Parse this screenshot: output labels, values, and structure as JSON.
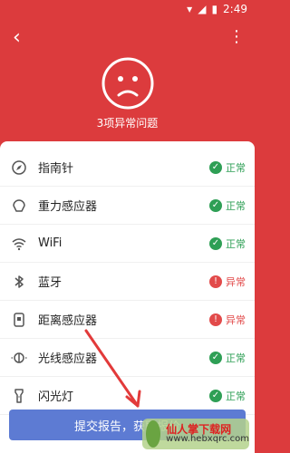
{
  "status_bar": {
    "time": "2:49",
    "icons": [
      "wifi-icon",
      "signal-icon",
      "battery-icon"
    ]
  },
  "header": {
    "back": "‹",
    "more": "⋮",
    "subtitle": "3项异常问题",
    "face_icon": "sad-face-icon"
  },
  "sensors": [
    {
      "icon": "compass-icon",
      "label": "指南针",
      "status": "正常",
      "state": "ok"
    },
    {
      "icon": "gravity-icon",
      "label": "重力感应器",
      "status": "正常",
      "state": "ok"
    },
    {
      "icon": "wifi-icon",
      "label": "WiFi",
      "status": "正常",
      "state": "ok"
    },
    {
      "icon": "bluetooth-icon",
      "label": "蓝牙",
      "status": "异常",
      "state": "bad"
    },
    {
      "icon": "proximity-icon",
      "label": "距离感应器",
      "status": "异常",
      "state": "bad"
    },
    {
      "icon": "light-sensor-icon",
      "label": "光线感应器",
      "status": "正常",
      "state": "ok"
    },
    {
      "icon": "flashlight-icon",
      "label": "闪光灯",
      "status": "正常",
      "state": "ok"
    }
  ],
  "button": {
    "label": "提交报告，获取报价"
  },
  "watermark": {
    "title": "仙人掌下载网",
    "site": "www.hebxqrc.com"
  },
  "colors": {
    "primary": "#dc3b3d",
    "ok": "#2e9f55",
    "bad": "#e24a4a",
    "button": "#5d7bd3"
  }
}
